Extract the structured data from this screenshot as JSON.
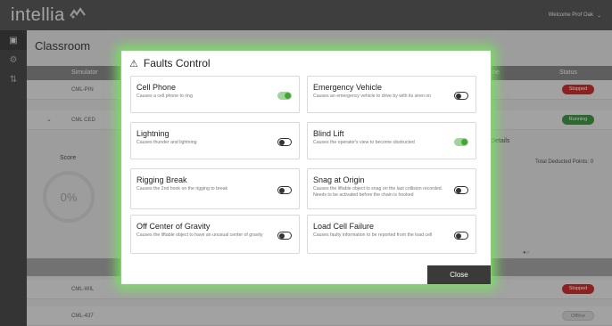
{
  "topbar": {
    "logo_text": "intellia",
    "logo_icon": "intellia-mark-icon",
    "welcome_text": "Welcome Prof Oak"
  },
  "sidebar": {
    "icons": [
      "dashboard-icon",
      "settings-icon",
      "sliders-icon"
    ]
  },
  "page": {
    "title": "Classroom",
    "columns": {
      "simulator": "Simulator",
      "time": "ne",
      "status": "Status"
    },
    "rows": [
      {
        "name": "CML-PIN",
        "status": "Stopped"
      },
      {
        "name": "CML CED",
        "status": "Running"
      },
      {
        "name": "CML-WIL",
        "status": "Stopped"
      },
      {
        "name": "CML-437",
        "status": "Offline"
      }
    ],
    "details_title": "Details",
    "score_label": "Score",
    "score_value": "0%",
    "deducted_label": "Total Deducted Points: 0"
  },
  "modal": {
    "title": "Faults Control",
    "close_label": "Close",
    "accent_color": "#6fd45b",
    "faults": [
      {
        "title": "Cell Phone",
        "desc": "Causes a cell phone to ring",
        "on": true
      },
      {
        "title": "Emergency Vehicle",
        "desc": "Causes an emergency vehicle to drive by with its siren on",
        "on": false
      },
      {
        "title": "Lightning",
        "desc": "Causes thunder and lightning",
        "on": false
      },
      {
        "title": "Blind Lift",
        "desc": "Causes the operator's view to become obstructed",
        "on": true
      },
      {
        "title": "Rigging Break",
        "desc": "Causes the 2nd hook on the rigging to break",
        "on": false
      },
      {
        "title": "Snag at Origin",
        "desc": "Causes the liftable object to snag on the last collision recorded. Needs to be activated before the chain is hooked",
        "on": false
      },
      {
        "title": "Off Center of Gravity",
        "desc": "Causes the liftable object to have an unusual center of gravity",
        "on": false
      },
      {
        "title": "Load Cell Failure",
        "desc": "Causes faulty information to be reported from the load cell",
        "on": false
      }
    ]
  }
}
